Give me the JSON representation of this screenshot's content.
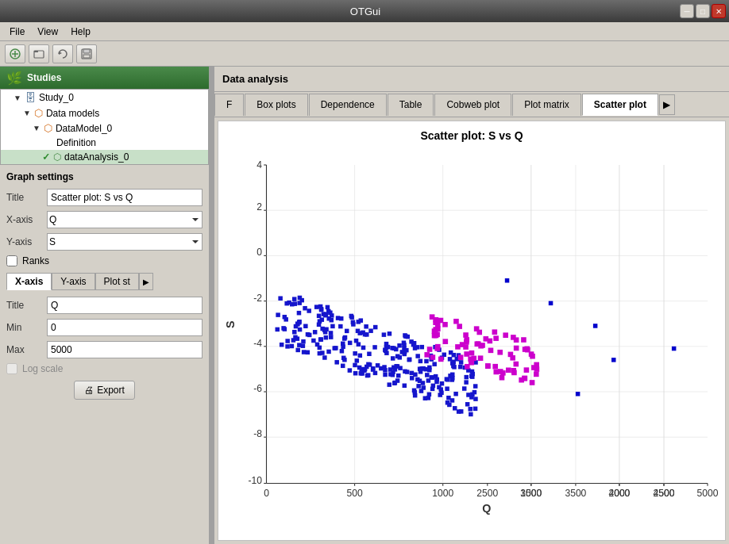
{
  "titleBar": {
    "title": "OTGui",
    "buttons": [
      "minimize",
      "maximize",
      "close"
    ]
  },
  "menuBar": {
    "items": [
      "File",
      "View",
      "Help"
    ]
  },
  "toolbar": {
    "buttons": [
      "new",
      "open",
      "refresh",
      "save"
    ]
  },
  "sidebar": {
    "studiesHeader": "Studies",
    "tree": [
      {
        "label": "Study_0",
        "indent": 1,
        "icon": "folder",
        "expanded": true
      },
      {
        "label": "Data models",
        "indent": 2,
        "icon": "db",
        "expanded": true
      },
      {
        "label": "DataModel_0",
        "indent": 3,
        "icon": "orange",
        "expanded": true
      },
      {
        "label": "Definition",
        "indent": 4,
        "icon": "none"
      },
      {
        "label": "dataAnalysis_0",
        "indent": 4,
        "icon": "check",
        "selected": true
      }
    ]
  },
  "graphSettings": {
    "title": "Graph settings",
    "titleLabel": "Title",
    "titleValue": "Scatter plot: S vs Q",
    "xAxisLabel": "X-axis",
    "xAxisValue": "Q",
    "yAxisLabel": "Y-axis",
    "yAxisValue": "S",
    "ranksLabel": "Ranks",
    "subTabs": [
      "X-axis",
      "Y-axis",
      "Plot st"
    ],
    "activeSubTab": "X-axis",
    "fields": {
      "title": {
        "label": "Title",
        "value": "Q"
      },
      "min": {
        "label": "Min",
        "value": "0"
      },
      "max": {
        "label": "Max",
        "value": "5000"
      }
    },
    "logScale": "Log scale",
    "exportBtn": "Export"
  },
  "rightPanel": {
    "header": "Data analysis",
    "tabs": [
      "F",
      "Box plots",
      "Dependence",
      "Table",
      "Cobweb plot",
      "Plot matrix",
      "Scatter plot"
    ],
    "activeTab": "Scatter plot"
  },
  "chart": {
    "title": "Scatter plot: S vs Q",
    "xAxisLabel": "Q",
    "yAxisLabel": "S",
    "xMin": 0,
    "xMax": 5000,
    "yMin": -10,
    "yMax": 4,
    "xTicks": [
      0,
      500,
      1000,
      1500,
      2000,
      2500,
      3000,
      3500,
      4000,
      4500,
      5000
    ],
    "yTicks": [
      -10,
      -8,
      -6,
      -4,
      -2,
      0,
      2,
      4
    ]
  }
}
